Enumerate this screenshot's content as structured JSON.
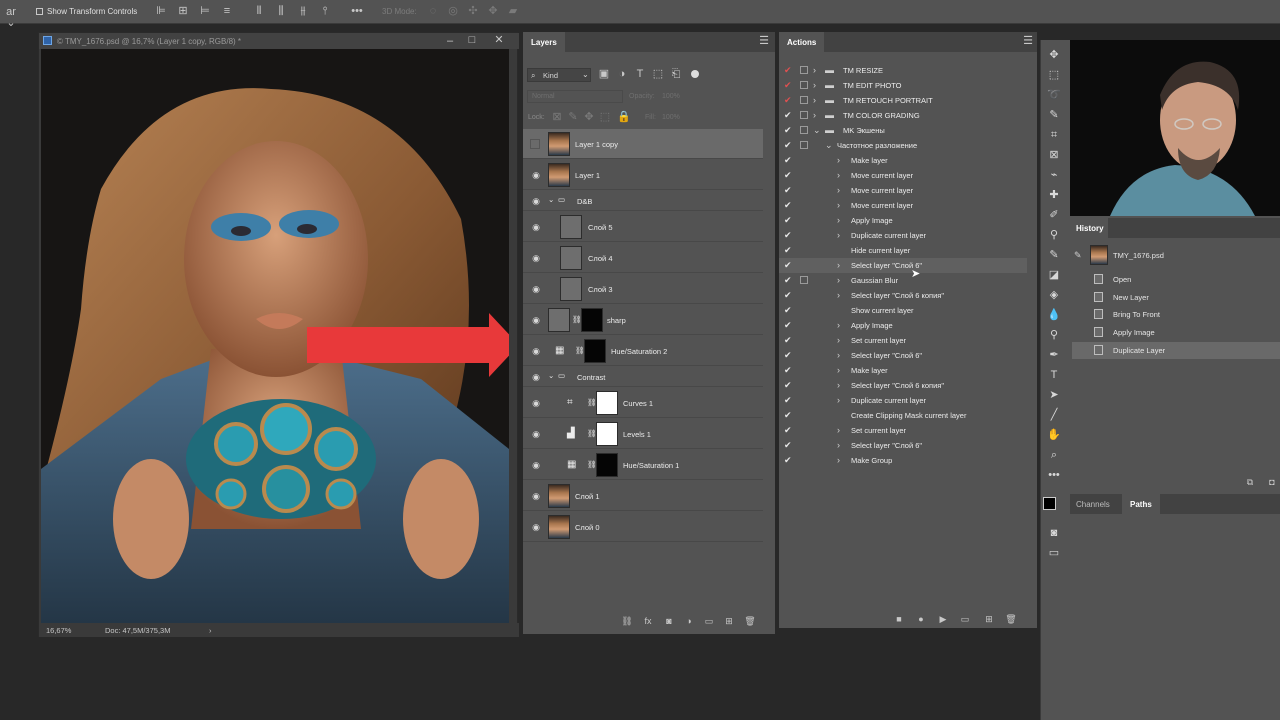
{
  "options_bar": {
    "show_transform_label": "Show Transform Controls",
    "mode_3d_label": "3D Mode:"
  },
  "document": {
    "tab_title": "© TMY_1676.psd @ 16,7% (Layer 1 copy, RGB/8) *",
    "zoom": "16,67%",
    "doc_size": "Doc: 47,5M/375,3M"
  },
  "layers_panel": {
    "title": "Layers",
    "kind_label": "Kind",
    "blend_mode": "Normal",
    "opacity_label": "Opacity:",
    "opacity_value": "100%",
    "lock_label": "Lock:",
    "fill_label": "Fill:",
    "fill_value": "100%",
    "layers": [
      {
        "name": "Layer 1 copy"
      },
      {
        "name": "Layer 1"
      },
      {
        "name": "D&B"
      },
      {
        "name": "Слой 5"
      },
      {
        "name": "Слой 4"
      },
      {
        "name": "Слой 3"
      },
      {
        "name": "sharp"
      },
      {
        "name": "Hue/Saturation 2"
      },
      {
        "name": "Contrast"
      },
      {
        "name": "Curves 1"
      },
      {
        "name": "Levels 1"
      },
      {
        "name": "Hue/Saturation 1"
      },
      {
        "name": "Слой 1"
      },
      {
        "name": "Слой 0"
      }
    ]
  },
  "actions_panel": {
    "title": "Actions",
    "sets": [
      {
        "label": "TM RESIZE"
      },
      {
        "label": "TM EDIT PHOTO"
      },
      {
        "label": "TM RETOUCH PORTRAIT"
      },
      {
        "label": "TM COLOR GRADING"
      },
      {
        "label": "MK Экшены"
      }
    ],
    "action_name": "Частотное разложение",
    "steps": [
      {
        "label": "Make layer"
      },
      {
        "label": "Move current layer"
      },
      {
        "label": "Move current layer"
      },
      {
        "label": "Move current layer"
      },
      {
        "label": "Apply Image"
      },
      {
        "label": "Duplicate current layer"
      },
      {
        "label": "Hide current layer"
      },
      {
        "label": "Select layer \"Слой 6\""
      },
      {
        "label": "Gaussian Blur"
      },
      {
        "label": "Select layer \"Слой 6 копия\""
      },
      {
        "label": "Show current layer"
      },
      {
        "label": "Apply Image"
      },
      {
        "label": "Set current layer"
      },
      {
        "label": "Select layer \"Слой 6\""
      },
      {
        "label": "Make layer"
      },
      {
        "label": "Select layer \"Слой 6 копия\""
      },
      {
        "label": "Duplicate current layer"
      },
      {
        "label": "Create Clipping Mask current layer"
      },
      {
        "label": "Set current layer"
      },
      {
        "label": "Select layer \"Слой 6\""
      },
      {
        "label": "Make Group"
      }
    ]
  },
  "history_panel": {
    "title": "History",
    "snapshot": "TMY_1676.psd",
    "items": [
      {
        "label": "Open"
      },
      {
        "label": "New Layer"
      },
      {
        "label": "Bring To Front"
      },
      {
        "label": "Apply Image"
      },
      {
        "label": "Duplicate Layer"
      }
    ]
  },
  "paths_panel": {
    "tabs": [
      {
        "label": "Channels"
      },
      {
        "label": "Paths"
      }
    ]
  },
  "colors": {
    "arrow": "#e8393a",
    "panel_bg": "#535353",
    "selection": "#6a6a6a"
  }
}
